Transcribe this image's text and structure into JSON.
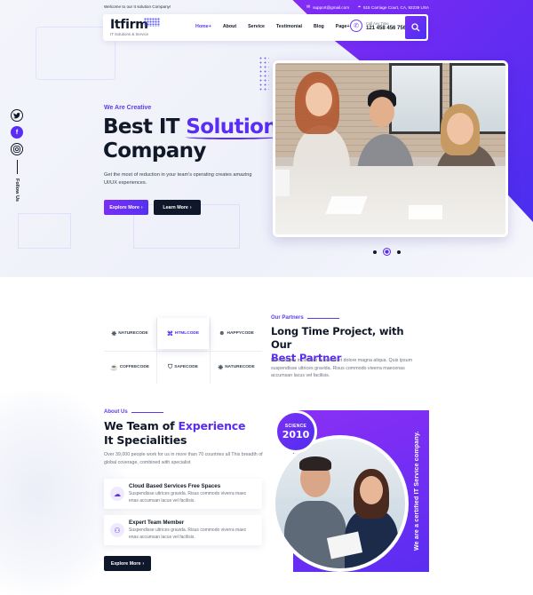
{
  "topbar": {
    "welcome": "Welcome to our  It solution Company!",
    "email": "support@gmail.com",
    "address": "515 Carriage Court, CA, 92236 USA"
  },
  "header": {
    "logo_name": "Itfirm",
    "logo_tagline": "IT Solutions & Service",
    "nav": [
      {
        "label": "Home+",
        "active": true
      },
      {
        "label": "About"
      },
      {
        "label": "Service"
      },
      {
        "label": "Testimonial"
      },
      {
        "label": "Blog"
      },
      {
        "label": "Page+"
      }
    ],
    "call_label": "Call Any Time",
    "call_number": "121 458 456 756",
    "search_icon": "search-icon"
  },
  "social": {
    "items": [
      "twitter-icon",
      "facebook-icon",
      "instagram-icon"
    ],
    "follow_label": "Follow Us"
  },
  "hero": {
    "eyebrow": "We Are Creative",
    "title_part1": "Best IT ",
    "title_highlight": "Solution",
    "title_part2": "Company",
    "description": "Get the most of reduction in your team's operating creates amazing UI/UX experiences.",
    "btn_explore": "Explore More",
    "btn_learn": "Learn More",
    "slider_active": 2,
    "slider_count": 3
  },
  "partners": {
    "kicker": "Our Partners",
    "title": "Long Time Project, with Our",
    "title_highlight": "Best Partner",
    "description": "Mod tempor incididunt ut labore et dolore magna aliqua. Quis ipsum suspendisse ultrices gravida. Risus commodo viverra maecenas accumsan lacus vel facilisis.",
    "logos": [
      {
        "name": "NATURECODE",
        "icon": "leaf-icon"
      },
      {
        "name": "HTMLCODE",
        "icon": "code-icon",
        "featured": true
      },
      {
        "name": "HAPPYCODE",
        "icon": "smile-icon"
      },
      {
        "name": "COFFEECODE",
        "icon": "cup-icon"
      },
      {
        "name": "SAFECODE",
        "icon": "shield-icon"
      },
      {
        "name": "NATURECODE",
        "icon": "leaf-icon"
      }
    ]
  },
  "about": {
    "kicker": "About Us",
    "title_part1": "We Team of ",
    "title_highlight": "Experience",
    "title_part2": "It Specialities",
    "description": "Over 39,000 people work for us in more than 70 countries all This breadth of global coverage, combined with specialist",
    "features": [
      {
        "title": "Cloud Based Services Free Spaces",
        "desc": "Suspendisse ultrices gravida. Risus commodo viverra maec enas accumsan lacus vel facilisis.",
        "icon": "cloud-icon"
      },
      {
        "title": "Expert Team Member",
        "desc": "Suspendisse ultrices gravida. Risus commodo viverra maec enas accumsan lacus vel facilisis.",
        "icon": "team-icon"
      }
    ],
    "btn_explore": "Explore More",
    "badge_label": "SCIENCE",
    "badge_year": "2010",
    "vertical_text": "We are a certified IT Service company."
  },
  "colors": {
    "accent": "#5b2cf2",
    "accent_2": "#8b2cf5",
    "dark": "#0f172a"
  }
}
